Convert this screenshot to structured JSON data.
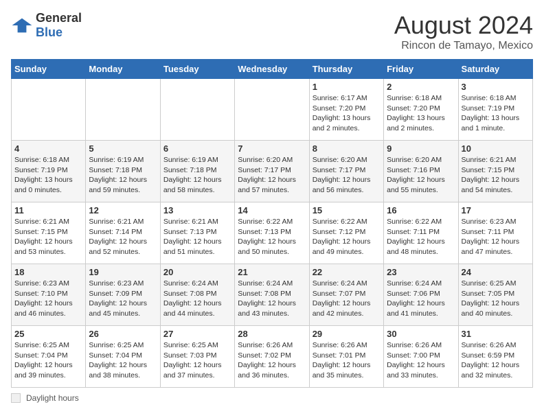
{
  "logo": {
    "general": "General",
    "blue": "Blue"
  },
  "header": {
    "month": "August 2024",
    "location": "Rincon de Tamayo, Mexico"
  },
  "columns": [
    "Sunday",
    "Monday",
    "Tuesday",
    "Wednesday",
    "Thursday",
    "Friday",
    "Saturday"
  ],
  "legend": {
    "label": "Daylight hours"
  },
  "weeks": [
    [
      {
        "day": "",
        "info": ""
      },
      {
        "day": "",
        "info": ""
      },
      {
        "day": "",
        "info": ""
      },
      {
        "day": "",
        "info": ""
      },
      {
        "day": "1",
        "info": "Sunrise: 6:17 AM\nSunset: 7:20 PM\nDaylight: 13 hours\nand 2 minutes."
      },
      {
        "day": "2",
        "info": "Sunrise: 6:18 AM\nSunset: 7:20 PM\nDaylight: 13 hours\nand 2 minutes."
      },
      {
        "day": "3",
        "info": "Sunrise: 6:18 AM\nSunset: 7:19 PM\nDaylight: 13 hours\nand 1 minute."
      }
    ],
    [
      {
        "day": "4",
        "info": "Sunrise: 6:18 AM\nSunset: 7:19 PM\nDaylight: 13 hours\nand 0 minutes."
      },
      {
        "day": "5",
        "info": "Sunrise: 6:19 AM\nSunset: 7:18 PM\nDaylight: 12 hours\nand 59 minutes."
      },
      {
        "day": "6",
        "info": "Sunrise: 6:19 AM\nSunset: 7:18 PM\nDaylight: 12 hours\nand 58 minutes."
      },
      {
        "day": "7",
        "info": "Sunrise: 6:20 AM\nSunset: 7:17 PM\nDaylight: 12 hours\nand 57 minutes."
      },
      {
        "day": "8",
        "info": "Sunrise: 6:20 AM\nSunset: 7:17 PM\nDaylight: 12 hours\nand 56 minutes."
      },
      {
        "day": "9",
        "info": "Sunrise: 6:20 AM\nSunset: 7:16 PM\nDaylight: 12 hours\nand 55 minutes."
      },
      {
        "day": "10",
        "info": "Sunrise: 6:21 AM\nSunset: 7:15 PM\nDaylight: 12 hours\nand 54 minutes."
      }
    ],
    [
      {
        "day": "11",
        "info": "Sunrise: 6:21 AM\nSunset: 7:15 PM\nDaylight: 12 hours\nand 53 minutes."
      },
      {
        "day": "12",
        "info": "Sunrise: 6:21 AM\nSunset: 7:14 PM\nDaylight: 12 hours\nand 52 minutes."
      },
      {
        "day": "13",
        "info": "Sunrise: 6:21 AM\nSunset: 7:13 PM\nDaylight: 12 hours\nand 51 minutes."
      },
      {
        "day": "14",
        "info": "Sunrise: 6:22 AM\nSunset: 7:13 PM\nDaylight: 12 hours\nand 50 minutes."
      },
      {
        "day": "15",
        "info": "Sunrise: 6:22 AM\nSunset: 7:12 PM\nDaylight: 12 hours\nand 49 minutes."
      },
      {
        "day": "16",
        "info": "Sunrise: 6:22 AM\nSunset: 7:11 PM\nDaylight: 12 hours\nand 48 minutes."
      },
      {
        "day": "17",
        "info": "Sunrise: 6:23 AM\nSunset: 7:11 PM\nDaylight: 12 hours\nand 47 minutes."
      }
    ],
    [
      {
        "day": "18",
        "info": "Sunrise: 6:23 AM\nSunset: 7:10 PM\nDaylight: 12 hours\nand 46 minutes."
      },
      {
        "day": "19",
        "info": "Sunrise: 6:23 AM\nSunset: 7:09 PM\nDaylight: 12 hours\nand 45 minutes."
      },
      {
        "day": "20",
        "info": "Sunrise: 6:24 AM\nSunset: 7:08 PM\nDaylight: 12 hours\nand 44 minutes."
      },
      {
        "day": "21",
        "info": "Sunrise: 6:24 AM\nSunset: 7:08 PM\nDaylight: 12 hours\nand 43 minutes."
      },
      {
        "day": "22",
        "info": "Sunrise: 6:24 AM\nSunset: 7:07 PM\nDaylight: 12 hours\nand 42 minutes."
      },
      {
        "day": "23",
        "info": "Sunrise: 6:24 AM\nSunset: 7:06 PM\nDaylight: 12 hours\nand 41 minutes."
      },
      {
        "day": "24",
        "info": "Sunrise: 6:25 AM\nSunset: 7:05 PM\nDaylight: 12 hours\nand 40 minutes."
      }
    ],
    [
      {
        "day": "25",
        "info": "Sunrise: 6:25 AM\nSunset: 7:04 PM\nDaylight: 12 hours\nand 39 minutes."
      },
      {
        "day": "26",
        "info": "Sunrise: 6:25 AM\nSunset: 7:04 PM\nDaylight: 12 hours\nand 38 minutes."
      },
      {
        "day": "27",
        "info": "Sunrise: 6:25 AM\nSunset: 7:03 PM\nDaylight: 12 hours\nand 37 minutes."
      },
      {
        "day": "28",
        "info": "Sunrise: 6:26 AM\nSunset: 7:02 PM\nDaylight: 12 hours\nand 36 minutes."
      },
      {
        "day": "29",
        "info": "Sunrise: 6:26 AM\nSunset: 7:01 PM\nDaylight: 12 hours\nand 35 minutes."
      },
      {
        "day": "30",
        "info": "Sunrise: 6:26 AM\nSunset: 7:00 PM\nDaylight: 12 hours\nand 33 minutes."
      },
      {
        "day": "31",
        "info": "Sunrise: 6:26 AM\nSunset: 6:59 PM\nDaylight: 12 hours\nand 32 minutes."
      }
    ]
  ]
}
